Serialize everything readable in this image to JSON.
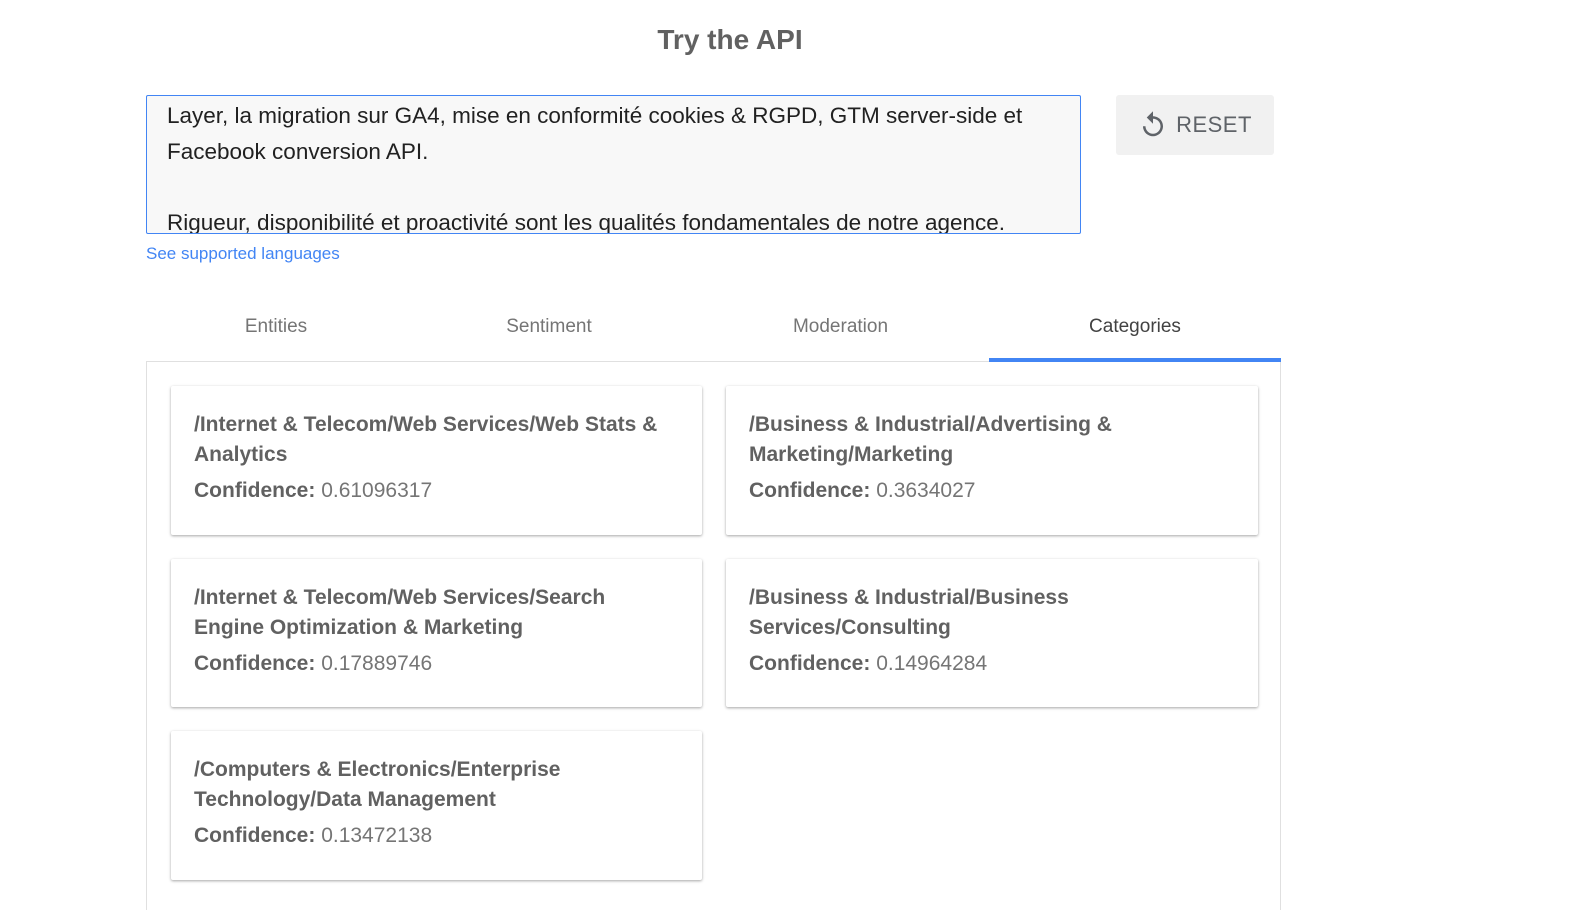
{
  "page": {
    "title": "Try the API"
  },
  "input": {
    "text": "Layer, la migration sur GA4, mise en conformité cookies & RGPD, GTM server-side et Facebook conversion API.\n\nRigueur, disponibilité et proactivité sont les qualités fondamentales de notre agence.",
    "reset_label": "RESET",
    "reset_icon": "refresh-icon",
    "languages_link": "See supported languages"
  },
  "tabs": [
    {
      "label": "Entities",
      "active": false
    },
    {
      "label": "Sentiment",
      "active": false
    },
    {
      "label": "Moderation",
      "active": false
    },
    {
      "label": "Categories",
      "active": true
    }
  ],
  "categories": [
    {
      "name": "/Internet & Telecom/Web Services/Web Stats & Analytics",
      "confidence_label": "Confidence:",
      "confidence": "0.61096317"
    },
    {
      "name": "/Business & Industrial/Advertising & Marketing/Marketing",
      "confidence_label": "Confidence:",
      "confidence": "0.3634027"
    },
    {
      "name": "/Internet & Telecom/Web Services/Search Engine Optimization & Marketing",
      "confidence_label": "Confidence:",
      "confidence": "0.17889746"
    },
    {
      "name": "/Business & Industrial/Business Services/Consulting",
      "confidence_label": "Confidence:",
      "confidence": "0.14964284"
    },
    {
      "name": "/Computers & Electronics/Enterprise Technology/Data Management",
      "confidence_label": "Confidence:",
      "confidence": "0.13472138"
    }
  ],
  "colors": {
    "accent": "#4285f4",
    "text": "#616161"
  }
}
